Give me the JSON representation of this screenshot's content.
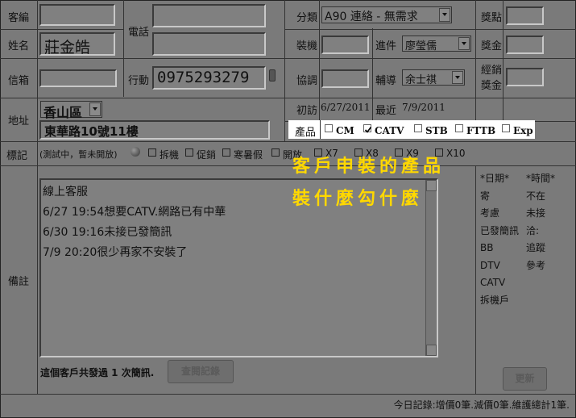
{
  "labels": {
    "customer_id": "客編",
    "name": "姓名",
    "email": "信箱",
    "address": "地址",
    "phone": "電話",
    "mobile": "行動",
    "category": "分類",
    "installer": "裝機",
    "progress": "進件",
    "coordinator": "協調",
    "assistant": "輔導",
    "first_visit": "初訪",
    "latest": "最近",
    "product": "產品",
    "reward_points": "獎點",
    "reward_amount": "獎金",
    "dealer_bonus": "經銷獎金",
    "mark": "標記",
    "remarks": "備註"
  },
  "fields": {
    "name": "莊金皓",
    "mobile": "0975293279",
    "district": "香山區",
    "street": "東華路10號11樓",
    "category": "A90 連絡 - 無需求",
    "progress_person": "廖瑩儒",
    "assistant_person": "余士祺",
    "first_visit_date": "6/27/2011",
    "latest_date": "7/9/2011"
  },
  "products": [
    {
      "label": "CM",
      "checked": false
    },
    {
      "label": "CATV",
      "checked": true
    },
    {
      "label": "STB",
      "checked": false
    },
    {
      "label": "FTTB",
      "checked": false
    },
    {
      "label": "Exp",
      "checked": false
    }
  ],
  "marks": {
    "testing_note": "(測試中，暫未開放)",
    "items": [
      "拆機",
      "促銷",
      "寒暑假",
      "開放",
      "X7",
      "X8",
      "X9",
      "X10"
    ]
  },
  "annotation": {
    "line1": "客戶申裝的產品",
    "line2": "裝什麼勾什麼",
    "color": "#ffd800"
  },
  "notes": [
    "線上客服",
    "6/27  19:54想要CATV.網路已有中華",
    "6/30  19:16未接已發簡訊",
    "7/9  20:20很少再家不安裝了"
  ],
  "quick_dates": {
    "header": "*日期*",
    "items": [
      "寄",
      "考慮",
      "已發簡訊",
      "BB",
      "DTV",
      "CATV",
      "拆機戶"
    ]
  },
  "quick_times": {
    "header": "*時間*",
    "items": [
      "不在",
      "未接",
      "洽:",
      "追蹤",
      "參考"
    ]
  },
  "sms_text": "這個客戶共發過 1 次簡訊.",
  "buttons": {
    "query_log": "查閱記錄",
    "update": "更新"
  },
  "footer": "今日記錄:增價0筆.減價0筆.維護總計1筆."
}
